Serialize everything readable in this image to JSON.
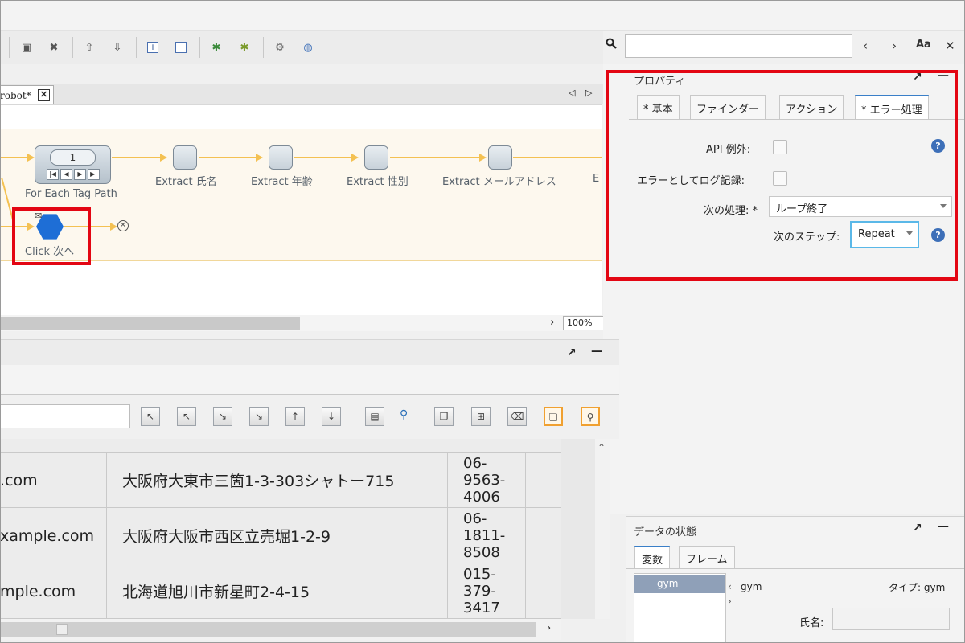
{
  "editor": {
    "tab_label": "robot*",
    "tab_close": "✕",
    "zoom": "100%"
  },
  "toolbar": {
    "icons": [
      "step-insert-icon",
      "step-delete-icon",
      "move-up-icon",
      "move-down-icon",
      "expand-icon",
      "collapse-icon",
      "debug-icon",
      "debug-step-icon",
      "settings-icon",
      "globe-icon"
    ]
  },
  "search": {
    "value": "",
    "prev": "‹",
    "next": "›",
    "match_case": "Aa",
    "close": "✕"
  },
  "flow": {
    "foreach_count": "1",
    "foreach_label": "For Each Tag Path",
    "steps": [
      "Extract 氏名",
      "Extract 年齢",
      "Extract 性別",
      "Extract メールアドレス",
      "E"
    ],
    "click_label": "Click 次へ"
  },
  "properties": {
    "title": "プロパティ",
    "tabs": [
      "基本",
      "ファインダー",
      "アクション",
      "エラー処理"
    ],
    "api_exception_label": "API 例外:",
    "log_error_label": "エラーとしてログ記録:",
    "next_action_label": "次の処理:",
    "next_action_value": "ループ終了",
    "next_step_label": "次のステップ:",
    "next_step_value": "Repeat",
    "help": "?"
  },
  "grid": {
    "rows": [
      {
        "email": ".com",
        "address": "大阪府大東市三箇1-3-303シャトー715",
        "phone": "06-9563-4006"
      },
      {
        "email": "xample.com",
        "address": "大阪府大阪市西区立売堀1-2-9",
        "phone": "06-1811-8508"
      },
      {
        "email": "mple.com",
        "address": "北海道旭川市新星町2-4-15",
        "phone": "015-379-3417"
      }
    ]
  },
  "data_state": {
    "title": "データの状態",
    "tabs": [
      "変数",
      "フレーム"
    ],
    "variable": "gym",
    "selected_name": "gym",
    "type_label": "タイプ: gym",
    "field_label": "氏名:"
  },
  "colors": {
    "highlight": "#e30613",
    "accent": "#3a7fc8",
    "node_click": "#1e6ed6",
    "connector": "#f4c152"
  }
}
